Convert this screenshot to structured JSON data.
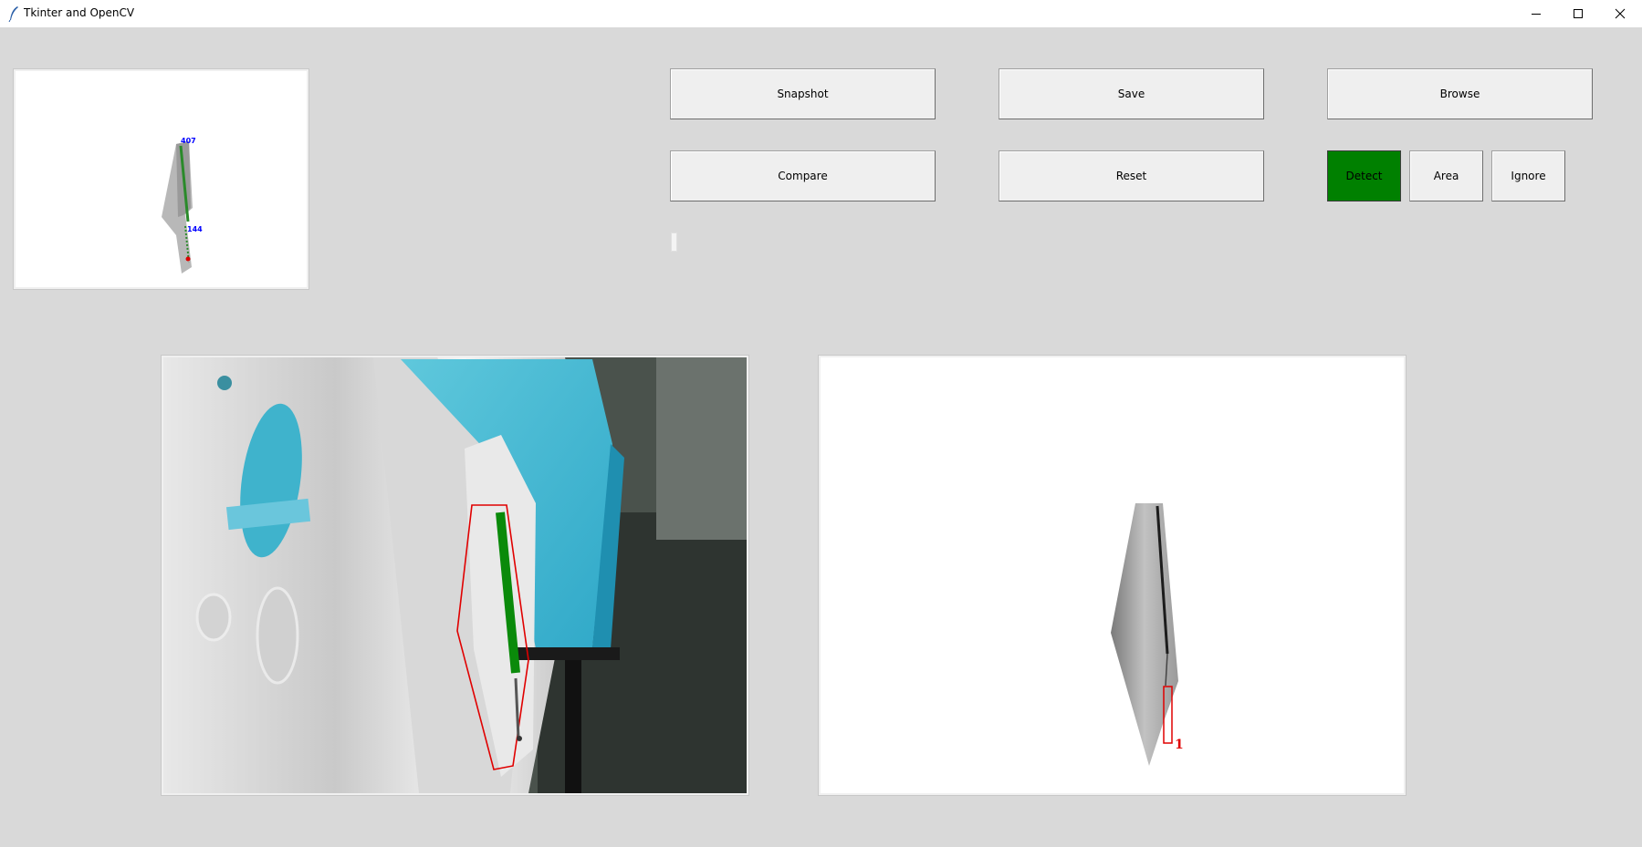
{
  "window": {
    "title": "Tkinter and OpenCV"
  },
  "buttons": {
    "snapshot": "Snapshot",
    "save": "Save",
    "browse": "Browse",
    "compare": "Compare",
    "reset": "Reset",
    "detect": "Detect",
    "area": "Area",
    "ignore": "Ignore"
  },
  "thumbnail": {
    "label_top": "407",
    "label_bottom": "144"
  },
  "result": {
    "defect_label": "1"
  },
  "colors": {
    "background": "#d9d9d9",
    "detect_active": "#008000",
    "annotation_red": "#e00000",
    "annotation_green": "#0a8a0a",
    "label_blue": "#0000ff"
  }
}
